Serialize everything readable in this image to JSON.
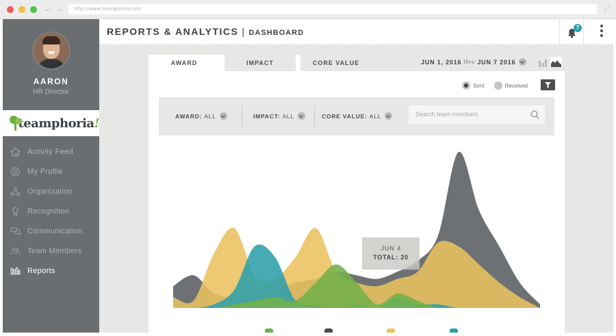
{
  "browser": {
    "url": "http://www.teamphoria.com"
  },
  "user": {
    "name": "AARON",
    "role": "HR Director"
  },
  "logo": {
    "text": "teamphoria",
    "mark": "!"
  },
  "sidebar": {
    "items": [
      {
        "label": "Activity Feed",
        "icon": "home-icon"
      },
      {
        "label": "My Profile",
        "icon": "user-icon"
      },
      {
        "label": "Organization",
        "icon": "network-icon"
      },
      {
        "label": "Recognition",
        "icon": "award-icon"
      },
      {
        "label": "Communication",
        "icon": "chat-icon"
      },
      {
        "label": "Team Members",
        "icon": "team-icon"
      },
      {
        "label": "Reports",
        "icon": "bars-icon",
        "active": true
      }
    ]
  },
  "header": {
    "title": "REPORTS & ANALYTICS",
    "separator": "|",
    "subtitle": "DASHBOARD",
    "notifications": "7"
  },
  "tabs": [
    {
      "label": "AWARD",
      "active": true
    },
    {
      "label": "IMPACT",
      "active": false
    },
    {
      "label": "CORE VALUE",
      "active": false
    }
  ],
  "date_range": {
    "start": "JUN 1, 2016",
    "thru": "thru",
    "end": "JUN 7 2016"
  },
  "toggle": {
    "sent": "Sent",
    "received": "Received",
    "selected": "Sent"
  },
  "filters": {
    "award_label": "AWARD:",
    "award_value": "ALL",
    "impact_label": "IMPACT:",
    "impact_value": "ALL",
    "core_label": "CORE VALUE:",
    "core_value": "ALL",
    "search_placeholder": "Search team members"
  },
  "tooltip": {
    "date": "JUN 4",
    "total": "TOTAL: 20"
  },
  "colors": {
    "gray": "#6e7174",
    "yellow": "#e9c15e",
    "teal": "#2e9fab",
    "green": "#72b04a",
    "sidebar": "#6a6e70",
    "accent": "#2a9fb0"
  },
  "chart_data": {
    "type": "area",
    "series": [
      {
        "color": "#6e7174",
        "values": [
          6,
          9,
          4,
          3,
          4,
          5,
          7,
          8,
          10,
          9,
          8,
          10,
          13,
          20,
          43,
          27,
          17,
          7,
          1
        ]
      },
      {
        "color": "#e9c15e",
        "values": [
          3,
          2,
          15,
          22,
          9,
          8,
          14,
          22,
          10,
          7,
          6,
          8,
          10,
          18,
          17,
          12,
          7,
          3,
          0
        ]
      },
      {
        "color": "#2e9fab",
        "values": [
          0,
          0,
          1,
          5,
          17,
          14,
          2,
          1,
          0,
          1,
          0,
          3,
          1,
          1,
          0,
          0,
          0,
          0,
          0
        ]
      },
      {
        "color": "#72b04a",
        "values": [
          0,
          0,
          0,
          1,
          2,
          3,
          2,
          7,
          12,
          7,
          1,
          4,
          2,
          0,
          0,
          0,
          0,
          0,
          0
        ]
      }
    ]
  }
}
